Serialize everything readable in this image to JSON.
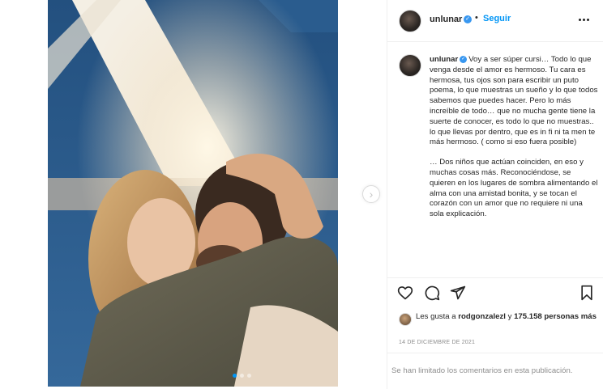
{
  "post": {
    "username": "unlunar",
    "follow_label": "Seguir",
    "separator": "•",
    "verified_icon": "verified-badge-icon",
    "caption_first": "Voy a ser súper cursi… Todo lo que venga desde el amor es hermoso. Tu cara es hermosa, tus ojos son para escribir un puto poema, lo que muestras un sueño y lo que todos sabemos que puedes hacer. Pero lo más increíble de todo… que no mucha gente tiene la suerte de conocer, es todo lo que no muestras.. lo que llevas por dentro, que es in fi ni ta men te más hermoso. ( como si eso fuera posible)",
    "caption_second": "… Dos niños que actúan coinciden, en eso y muchas cosas más. Reconociéndose, se quieren en los lugares de sombra alimentando el alma con una amistad bonita, y se tocan el corazón con un amor que no requiere ni una sola explicación.",
    "likes_prefix": "Les gusta a ",
    "likes_user": "rodgonzalezl",
    "likes_mid": " y ",
    "likes_count": "175.158 personas más",
    "date": "14 DE DICIEMBRE DE 2021",
    "comments_notice": "Se han limitado los comentarios en esta publicación."
  },
  "carousel": {
    "total": 3,
    "active_index": 0
  },
  "icons": {
    "like": "heart-icon",
    "comment": "comment-icon",
    "share": "send-icon",
    "save": "bookmark-icon",
    "more": "more-options-icon",
    "next": "chevron-right-icon"
  },
  "colors": {
    "accent": "#0095f6",
    "verified": "#3897f0",
    "muted_text": "#8e8e8e",
    "border": "#efefef"
  }
}
